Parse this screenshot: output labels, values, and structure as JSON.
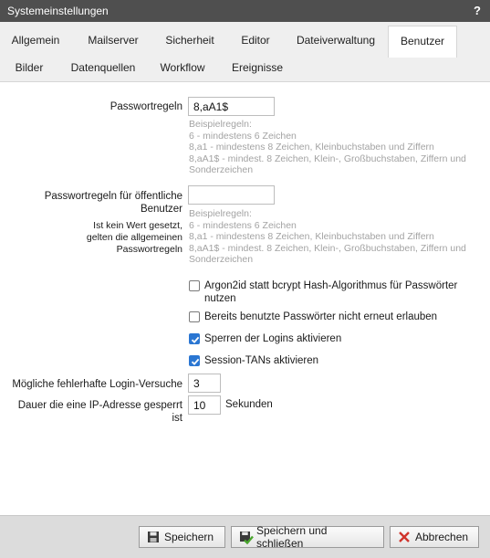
{
  "window": {
    "title": "Systemeinstellungen",
    "help": "?"
  },
  "tabs": [
    {
      "label": "Allgemein"
    },
    {
      "label": "Mailserver"
    },
    {
      "label": "Sicherheit"
    },
    {
      "label": "Editor"
    },
    {
      "label": "Dateiverwaltung"
    },
    {
      "label": "Benutzer",
      "active": true
    },
    {
      "label": "Bilder"
    },
    {
      "label": "Datenquellen"
    },
    {
      "label": "Workflow"
    },
    {
      "label": "Ereignisse"
    }
  ],
  "password_rules": {
    "label": "Passwortregeln",
    "value": "8,aA1$",
    "hints": [
      "Beispielregeln:",
      "6 - mindestens 6 Zeichen",
      "8,a1 - mindestens 8 Zeichen, Kleinbuchstaben und Ziffern",
      "8,aA1$ - mindest. 8 Zeichen, Klein-, Großbuchstaben, Ziffern und",
      "Sonderzeichen"
    ]
  },
  "public_password_rules": {
    "label_line1": "Passwortregeln für öffentliche",
    "label_line2": "Benutzer",
    "note_line1": "Ist kein Wert gesetzt,",
    "note_line2": "gelten die allgemeinen",
    "note_line3": "Passwortregeln",
    "value": "",
    "hints": [
      "Beispielregeln:",
      "6 - mindestens 6 Zeichen",
      "8,a1 - mindestens 8 Zeichen, Kleinbuchstaben und Ziffern",
      "8,aA1$ - mindest. 8 Zeichen, Klein-, Großbuchstaben, Ziffern und",
      "Sonderzeichen"
    ]
  },
  "checkboxes": [
    {
      "line1": "Argon2id statt bcrypt Hash-Algorithmus für Passwörter",
      "line2": "nutzen",
      "checked": false
    },
    {
      "line1": "Bereits benutzte Passwörter nicht erneut erlauben",
      "checked": false
    },
    {
      "line1": "Sperren der Logins aktivieren",
      "checked": true
    },
    {
      "line1": "Session-TANs aktivieren",
      "checked": true
    }
  ],
  "login_attempts": {
    "label": "Mögliche fehlerhafte Login-Versuche",
    "value": "3"
  },
  "ip_lock": {
    "label_line1": "Dauer die eine IP-Adresse gesperrt",
    "label_line2": "ist",
    "value": "10",
    "unit": "Sekunden"
  },
  "footer": {
    "save": "Speichern",
    "save_close": "Speichern und schließen",
    "cancel": "Abbrechen"
  },
  "colors": {
    "titlebar": "#4f4f4f",
    "checkbox_checked": "#2a76d2",
    "footer": "#dcdcdc",
    "cancel_icon": "#d0342c"
  }
}
